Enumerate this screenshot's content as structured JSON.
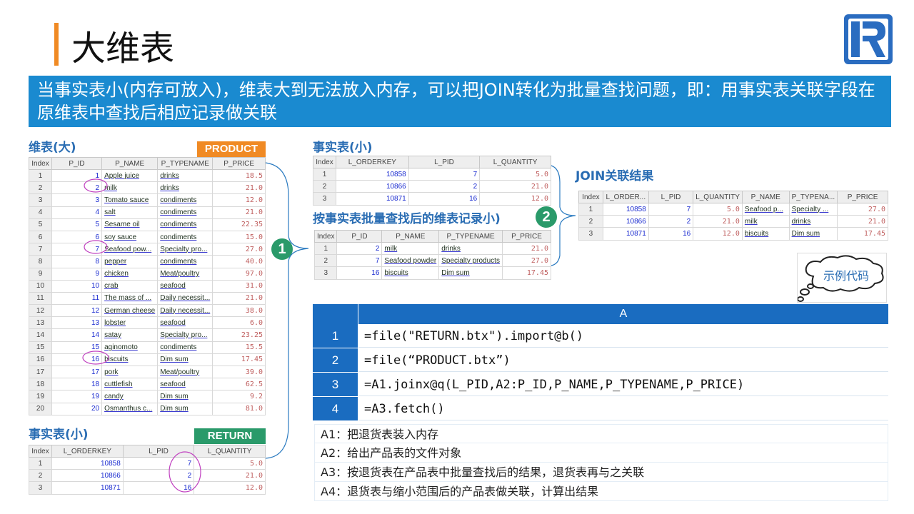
{
  "title": "大维表",
  "banner": "当事实表小(内存可放入)，维表大到无法放入内存，可以把JOIN转化为批量查找问题，即：用事实表关联字段在原维表中查找后相应记录做关联",
  "labels": {
    "dim_big": "维表(大)",
    "fact_small_top": "事实表(小)",
    "join_result": "JOIN关联结果",
    "filtered_dim": "按事实表批量查找后的维表记录小)",
    "fact_small_bottom": "事实表(小)",
    "product_tag": "PRODUCT",
    "return_tag": "RETURN",
    "step1": "1",
    "step2": "2",
    "sample_code": "示例代码"
  },
  "colors": {
    "banner": "#1a8ad0",
    "accent": "#f08a24",
    "product_tag": "#f08a24",
    "return_tag": "#2a9a6a",
    "code_header": "#1a6cc0"
  },
  "product_table": {
    "headers": [
      "Index",
      "P_ID",
      "P_NAME",
      "P_TYPENAME",
      "P_PRICE"
    ],
    "rows": [
      [
        "1",
        "1",
        "Apple juice",
        "drinks",
        "18.5"
      ],
      [
        "2",
        "2",
        "milk",
        "drinks",
        "21.0"
      ],
      [
        "3",
        "3",
        "Tomato sauce",
        "condiments",
        "12.0"
      ],
      [
        "4",
        "4",
        "salt",
        "condiments",
        "21.0"
      ],
      [
        "5",
        "5",
        "Sesame oil",
        "condiments",
        "22.35"
      ],
      [
        "6",
        "6",
        "soy sauce",
        "condiments",
        "15.0"
      ],
      [
        "7",
        "7",
        "Seafood pow...",
        "Specialty pro...",
        "27.0"
      ],
      [
        "8",
        "8",
        "pepper",
        "condiments",
        "40.0"
      ],
      [
        "9",
        "9",
        "chicken",
        "Meat/poultry",
        "97.0"
      ],
      [
        "10",
        "10",
        "crab",
        "seafood",
        "31.0"
      ],
      [
        "11",
        "11",
        "The mass of ...",
        "Daily necessit...",
        "21.0"
      ],
      [
        "12",
        "12",
        "German cheese",
        "Daily necessit...",
        "38.0"
      ],
      [
        "13",
        "13",
        "lobster",
        "seafood",
        "6.0"
      ],
      [
        "14",
        "14",
        "satay",
        "Specialty pro...",
        "23.25"
      ],
      [
        "15",
        "15",
        "aginomoto",
        "condiments",
        "15.5"
      ],
      [
        "16",
        "16",
        "biscuits",
        "Dim sum",
        "17.45"
      ],
      [
        "17",
        "17",
        "pork",
        "Meat/poultry",
        "39.0"
      ],
      [
        "18",
        "18",
        "cuttlefish",
        "seafood",
        "62.5"
      ],
      [
        "19",
        "19",
        "candy",
        "Dim sum",
        "9.2"
      ],
      [
        "20",
        "20",
        "Osmanthus c...",
        "Dim sum",
        "81.0"
      ]
    ]
  },
  "fact_table_top": {
    "headers": [
      "Index",
      "L_ORDERKEY",
      "L_PID",
      "L_QUANTITY"
    ],
    "rows": [
      [
        "1",
        "10858",
        "7",
        "5.0"
      ],
      [
        "2",
        "10866",
        "2",
        "21.0"
      ],
      [
        "3",
        "10871",
        "16",
        "12.0"
      ]
    ]
  },
  "fact_table_bottom": {
    "headers": [
      "Index",
      "L_ORDERKEY",
      "L_PID",
      "L_QUANTITY"
    ],
    "rows": [
      [
        "1",
        "10858",
        "7",
        "5.0"
      ],
      [
        "2",
        "10866",
        "2",
        "21.0"
      ],
      [
        "3",
        "10871",
        "16",
        "12.0"
      ]
    ]
  },
  "filtered_table": {
    "headers": [
      "Index",
      "P_ID",
      "P_NAME",
      "P_TYPENAME",
      "P_PRICE"
    ],
    "rows": [
      [
        "1",
        "2",
        "milk",
        "drinks",
        "21.0"
      ],
      [
        "2",
        "7",
        "Seafood powder",
        "Specialty products",
        "27.0"
      ],
      [
        "3",
        "16",
        "biscuits",
        "Dim sum",
        "17.45"
      ]
    ]
  },
  "join_table": {
    "headers": [
      "Index",
      "L_ORDER...",
      "L_PID",
      "L_QUANTITY",
      "P_NAME",
      "P_TYPENA...",
      "P_PRICE"
    ],
    "rows": [
      [
        "1",
        "10858",
        "7",
        "5.0",
        "Seafood p...",
        "Specialty ...",
        "27.0"
      ],
      [
        "2",
        "10866",
        "2",
        "21.0",
        "milk",
        "drinks",
        "21.0"
      ],
      [
        "3",
        "10871",
        "16",
        "12.0",
        "biscuits",
        "Dim sum",
        "17.45"
      ]
    ]
  },
  "code": {
    "column": "A",
    "rows": [
      {
        "n": "1",
        "text": "=file(\"RETURN.btx\").import@b()"
      },
      {
        "n": "2",
        "text": "=file(“PRODUCT.btx”)"
      },
      {
        "n": "3",
        "text": "=A1.joinx@q(L_PID,A2:P_ID,P_NAME,P_TYPENAME,P_PRICE)"
      },
      {
        "n": "4",
        "text": "=A3.fetch()"
      }
    ]
  },
  "notes": [
    "A1：把退货表装入内存",
    "A2：给出产品表的文件对象",
    "A3：按退货表在产品表中批量查找后的结果，退货表再与之关联",
    "A4：退货表与缩小范围后的产品表做关联，计算出结果"
  ]
}
